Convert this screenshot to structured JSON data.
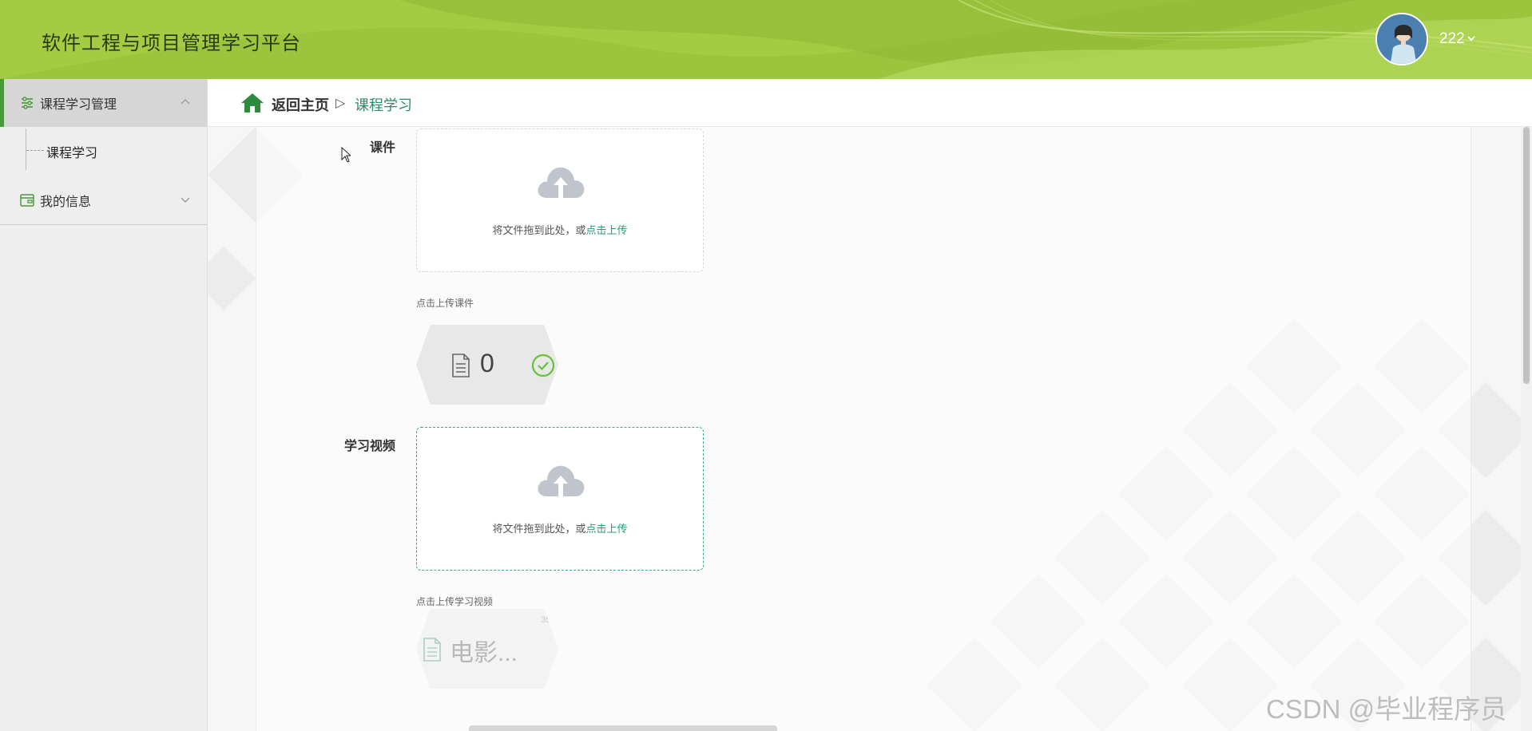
{
  "header": {
    "title": "软件工程与项目管理学习平台",
    "username": "222",
    "brand_color": "#9bc53d"
  },
  "sidebar": {
    "menus": [
      {
        "label": "课程学习管理",
        "icon": "sliders-icon",
        "expanded": true,
        "items": [
          {
            "label": "课程学习"
          }
        ]
      },
      {
        "label": "我的信息",
        "icon": "wallet-icon",
        "expanded": false,
        "items": []
      }
    ]
  },
  "breadcrumb": {
    "home": "返回主页",
    "separator": "▷",
    "current": "课程学习"
  },
  "form": {
    "courseware": {
      "label": "课件",
      "drop_text": "将文件拖到此处，或",
      "drop_link": "点击上传",
      "tip": "点击上传课件",
      "file_count": "0"
    },
    "video": {
      "label": "学习视频",
      "drop_text": "将文件拖到此处，或",
      "drop_link": "点击上传",
      "tip": "点击上传学习视频",
      "file_name": "电影...",
      "file_num": "35"
    }
  },
  "watermark": "CSDN @毕业程序员"
}
